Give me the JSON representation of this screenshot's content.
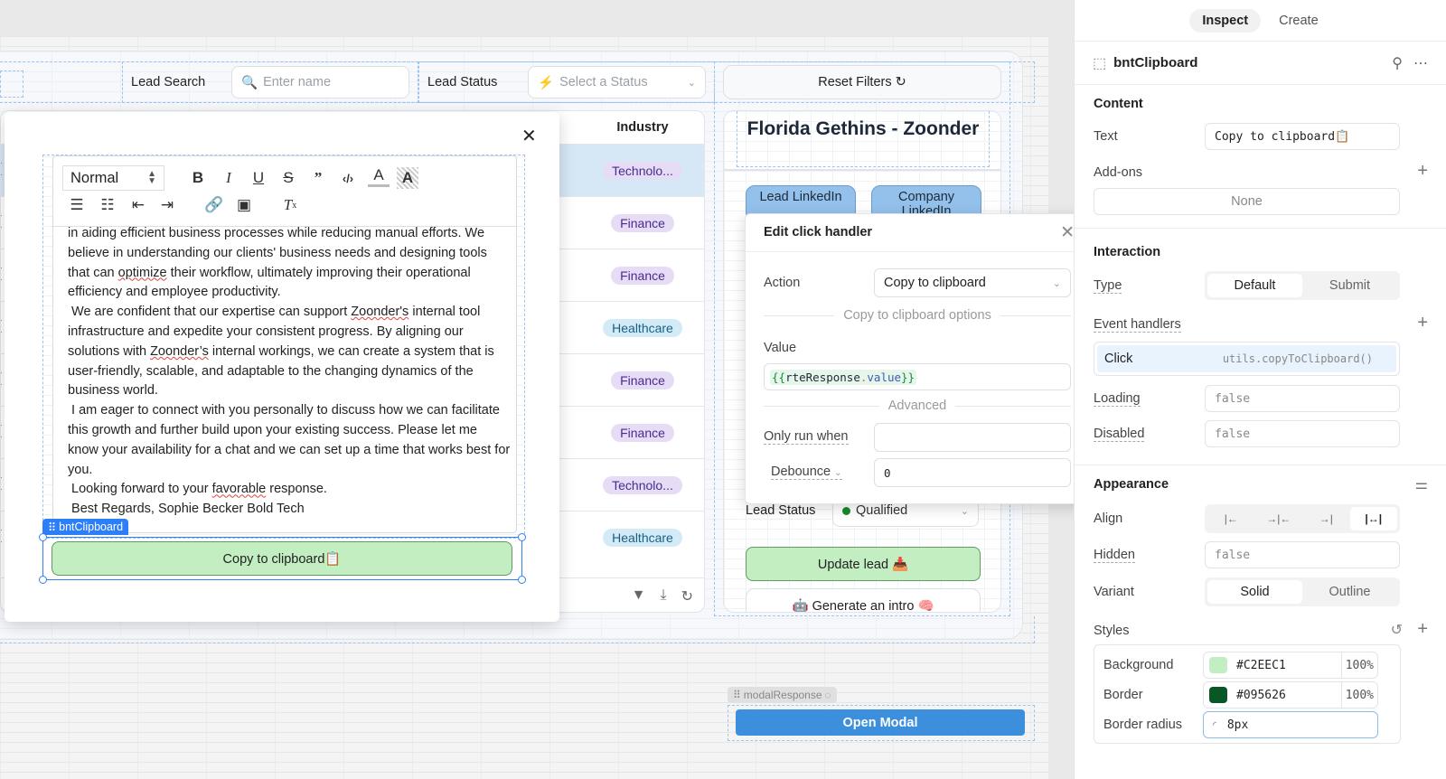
{
  "filters": {
    "lead_search_label": "Lead Search",
    "lead_search_placeholder": "Enter name",
    "lead_status_label": "Lead Status",
    "lead_status_placeholder": "Select a Status",
    "reset_label": "Reset Filters ↻"
  },
  "table": {
    "industry_header": "Industry",
    "rows": [
      {
        "industry": "Technolo...",
        "style": "purple",
        "selected": true
      },
      {
        "industry": "Finance",
        "style": "purple"
      },
      {
        "industry": "Finance",
        "style": "purple"
      },
      {
        "industry": "Healthcare",
        "style": "teal"
      },
      {
        "industry": "Finance",
        "style": "purple"
      },
      {
        "industry": "Finance",
        "style": "purple"
      },
      {
        "industry": "Technolo...",
        "style": "purple"
      },
      {
        "industry": "Healthcare",
        "style": "teal"
      }
    ],
    "footer_icons": [
      "filter-icon",
      "download-icon",
      "refresh-icon"
    ]
  },
  "detail": {
    "title": "Florida Gethins - Zoonder",
    "lead_linkedin": "Lead LinkedIn",
    "company_linkedin": "Company LinkedIn",
    "lead_status_label": "Lead Status",
    "lead_status_value": "Qualified",
    "update_label": "Update lead 📥",
    "generate_label": "🤖 Generate an intro 🧠"
  },
  "modal_response": {
    "tag": "modalResponse",
    "open_modal_label": "Open Modal"
  },
  "rte_modal": {
    "format_value": "Normal",
    "toolbar": [
      "bold",
      "italic",
      "underline",
      "strike",
      "blockquote",
      "code",
      "font-color",
      "background-color",
      "ordered-list",
      "bullet-list",
      "outdent",
      "indent",
      "link",
      "image",
      "clear-format"
    ],
    "paragraphs": [
      "in aiding efficient business processes while reducing manual efforts. We believe in understanding our clients' business needs and designing tools that can optimize their workflow, ultimately improving their operational efficiency and employee productivity.",
      " We are confident that our expertise can support Zoonder's internal tool infrastructure and expedite your consistent progress. By aligning our solutions with Zoonder’s internal workings, we can create a system that is user-friendly, scalable, and adaptable to the changing dynamics of the business world.",
      " I am eager to connect with you personally to discuss how we can facilitate this growth and further build upon your existing success. Please let me know your availability for a chat and we can set up a time that works best for you.",
      " Looking forward to your favorable response.",
      " Best Regards, Sophie Becker Bold Tech"
    ],
    "selected_tag": "bntClipboard",
    "copy_button_label": "Copy to clipboard📋"
  },
  "handler_popup": {
    "title": "Edit click handler",
    "action_label": "Action",
    "action_value": "Copy to clipboard",
    "options_divider": "Copy to clipboard options",
    "value_label": "Value",
    "value_open": "{{",
    "value_name": "rteResponse",
    "value_dot": ".",
    "value_prop": "value",
    "value_close": "}}",
    "advanced_divider": "Advanced",
    "only_run_label": "Only run when",
    "only_run_value": "",
    "debounce_label": "Debounce",
    "debounce_value": "0"
  },
  "inspector": {
    "tabs": [
      {
        "label": "Inspect",
        "active": true
      },
      {
        "label": "Create",
        "active": false
      }
    ],
    "component_name": "bntClipboard",
    "content": {
      "title": "Content",
      "text_label": "Text",
      "text_value": "Copy to clipboard📋",
      "addons_label": "Add-ons",
      "addons_value": "None"
    },
    "interaction": {
      "title": "Interaction",
      "type_label": "Type",
      "type_options": [
        "Default",
        "Submit"
      ],
      "type_selected": "Default",
      "event_handlers_label": "Event handlers",
      "handler_event": "Click",
      "handler_action": "utils.copyToClipboard()",
      "loading_label": "Loading",
      "loading_value": "false",
      "disabled_label": "Disabled",
      "disabled_value": "false"
    },
    "appearance": {
      "title": "Appearance",
      "align_label": "Align",
      "align_options": [
        "|←",
        "→|←",
        "→|",
        "|↔|"
      ],
      "align_selected": 3,
      "hidden_label": "Hidden",
      "hidden_value": "false",
      "variant_label": "Variant",
      "variant_options": [
        "Solid",
        "Outline"
      ],
      "variant_selected": "Solid"
    },
    "styles": {
      "title": "Styles",
      "background_label": "Background",
      "background_value": "#C2EEC1",
      "background_opacity": "100%",
      "border_label": "Border",
      "border_value": "#095626",
      "border_opacity": "100%",
      "radius_label": "Border radius",
      "radius_value": "8px"
    }
  },
  "colors": {
    "accent_blue": "#2d7ff9",
    "button_green_bg": "#C2EEC1",
    "button_green_border": "#095626",
    "open_modal_blue": "#3c8fdc"
  }
}
